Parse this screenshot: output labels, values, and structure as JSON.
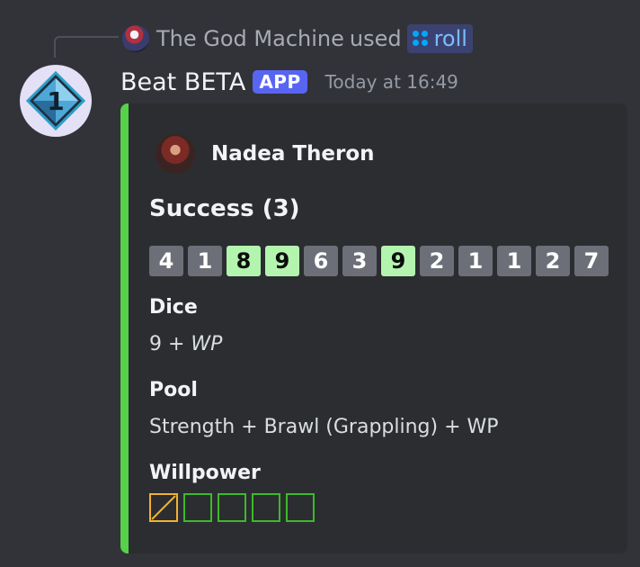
{
  "reply": {
    "user_name": "The God Machine",
    "used_text": "used",
    "command_name": "roll",
    "command_icon": "app-command-icon"
  },
  "message": {
    "avatar_number": "1",
    "author": "Beat BETA",
    "badge": "APP",
    "timestamp": "Today at 16:49"
  },
  "embed": {
    "accent_color": "#57d04a",
    "author_name": "Nadea Theron",
    "title": "Success (3)",
    "dice": [
      {
        "value": "4",
        "success": false
      },
      {
        "value": "1",
        "success": false
      },
      {
        "value": "8",
        "success": true
      },
      {
        "value": "9",
        "success": true
      },
      {
        "value": "6",
        "success": false
      },
      {
        "value": "3",
        "success": false
      },
      {
        "value": "9",
        "success": true
      },
      {
        "value": "2",
        "success": false
      },
      {
        "value": "1",
        "success": false
      },
      {
        "value": "1",
        "success": false
      },
      {
        "value": "2",
        "success": false
      },
      {
        "value": "7",
        "success": false
      }
    ],
    "fields": {
      "dice": {
        "name": "Dice",
        "value_plain": "9 + ",
        "value_italic": "WP"
      },
      "pool": {
        "name": "Pool",
        "value": "Strength + Brawl (Grappling) + WP"
      },
      "willpower": {
        "name": "Willpower",
        "boxes": [
          "spent",
          "available",
          "available",
          "available",
          "available"
        ]
      }
    }
  },
  "colors": {
    "success_die": "#b3f5ae",
    "normal_die": "#6d6f78",
    "willpower_available": "#3dba2a",
    "willpower_spent": "#f0b232",
    "app_badge": "#5865f2"
  }
}
